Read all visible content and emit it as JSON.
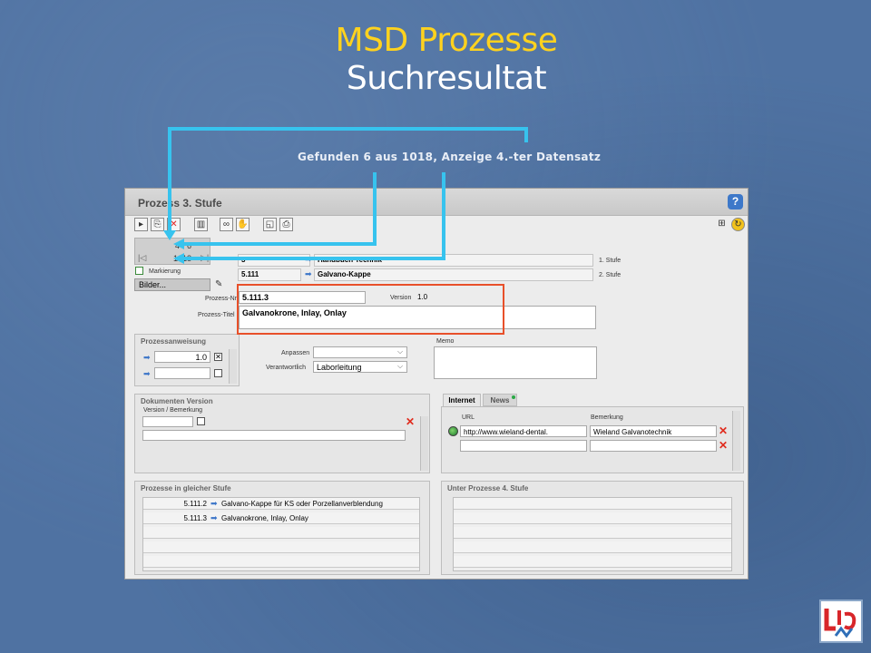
{
  "slide": {
    "title": "MSD Prozesse",
    "subtitle": "Suchresultat",
    "annotation": "Gefunden  6  aus  1018, Anzeige 4.-ter Datensatz"
  },
  "window": {
    "title": "Prozess 3. Stufe",
    "help": "?",
    "nav": {
      "range": "4  -  6",
      "total": "1018"
    },
    "markierung_label": "Markierung",
    "bilder_button": "Bilder...",
    "hierarchy": [
      {
        "number": "3",
        "title": "Handbuch Technik",
        "level": "1. Stufe"
      },
      {
        "number": "5.111",
        "title": "Galvano-Kappe",
        "level": "2. Stufe"
      }
    ],
    "prozess_nr_label": "Prozess-Nr.",
    "prozess_nr": "5.111.3",
    "version_label": "Version",
    "version": "1.0",
    "prozess_titel_label": "Prozess-Titel",
    "prozess_titel": "Galvanokrone, Inlay, Onlay",
    "memo_label": "Memo",
    "anpassen_label": "Anpassen",
    "anpassen_value": "",
    "verantwortlich_label": "Verantwortlich",
    "verantwortlich_value": "Laborleitung",
    "prozessanweisung": {
      "title": "Prozessanweisung",
      "rows": [
        "1.0",
        ""
      ]
    },
    "dokumenten_version": {
      "title": "Dokumenten Version",
      "column": "Version / Bemerkung"
    },
    "tabs": [
      "Internet",
      "News"
    ],
    "internet": {
      "url_header": "URL",
      "bemerkung_header": "Bemerkung",
      "rows": [
        {
          "url": "http://www.wieland-dental.",
          "bemerkung": "Wieland Galvanotechnik"
        }
      ]
    },
    "gleiche_stufe": {
      "title": "Prozesse in gleicher Stufe",
      "rows": [
        {
          "number": "5.111.2",
          "title": "Galvano-Kappe für KS oder Porzellanverblendung"
        },
        {
          "number": "5.111.3",
          "title": "Galvanokrone, Inlay, Onlay"
        }
      ]
    },
    "unter_prozesse": {
      "title": "Unter Prozesse 4. Stufe"
    }
  },
  "colors": {
    "accent_yellow": "#ffd21e",
    "arrow_cyan": "#37c3ee",
    "highlight_red": "#e8502a",
    "background": "#4f72a2"
  },
  "icons": [
    "first-icon",
    "copy-icon",
    "delete-icon",
    "book-icon",
    "binoculars-icon",
    "hand-icon",
    "preview-icon",
    "print-icon",
    "tree-icon",
    "status-icon",
    "edit-icon",
    "globe-icon"
  ]
}
